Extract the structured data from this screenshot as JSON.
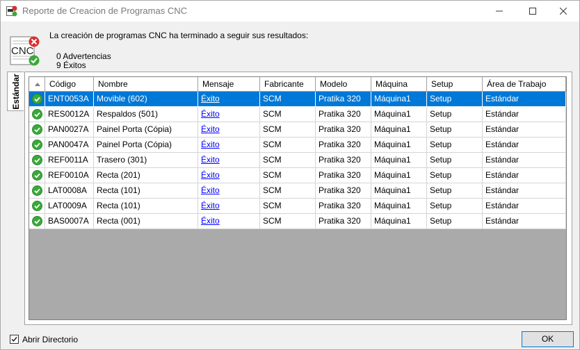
{
  "window": {
    "title": "Reporte de Creacion de Programas CNC"
  },
  "header": {
    "icon_text": "CNC",
    "message": "La creación de programas CNC ha terminado a seguir sus resultados:",
    "warnings": "0 Advertencias",
    "successes": "9 Éxitos"
  },
  "tab": {
    "label": "Estándar"
  },
  "grid": {
    "columns": [
      "Código",
      "Nombre",
      "Mensaje",
      "Fabricante",
      "Modelo",
      "Máquina",
      "Setup",
      "Área de Trabajo"
    ],
    "rows": [
      {
        "codigo": "ENT0053A",
        "nombre": "Movible (602)",
        "mensaje": "Éxito",
        "fabricante": "SCM",
        "modelo": "Pratika 320",
        "maquina": "Máquina1",
        "setup": "Setup",
        "area": "Estándar",
        "selected": true
      },
      {
        "codigo": "RES0012A",
        "nombre": "Respaldos (501)",
        "mensaje": "Éxito",
        "fabricante": "SCM",
        "modelo": "Pratika 320",
        "maquina": "Máquina1",
        "setup": "Setup",
        "area": "Estándar"
      },
      {
        "codigo": "PAN0027A",
        "nombre": "Painel Porta (Cópia)",
        "mensaje": "Éxito",
        "fabricante": "SCM",
        "modelo": "Pratika 320",
        "maquina": "Máquina1",
        "setup": "Setup",
        "area": "Estándar"
      },
      {
        "codigo": "PAN0047A",
        "nombre": "Painel Porta (Cópia)",
        "mensaje": "Éxito",
        "fabricante": "SCM",
        "modelo": "Pratika 320",
        "maquina": "Máquina1",
        "setup": "Setup",
        "area": "Estándar"
      },
      {
        "codigo": "REF0011A",
        "nombre": "Trasero (301)",
        "mensaje": "Éxito",
        "fabricante": "SCM",
        "modelo": "Pratika 320",
        "maquina": "Máquina1",
        "setup": "Setup",
        "area": "Estándar"
      },
      {
        "codigo": "REF0010A",
        "nombre": "Recta (201)",
        "mensaje": "Éxito",
        "fabricante": "SCM",
        "modelo": "Pratika 320",
        "maquina": "Máquina1",
        "setup": "Setup",
        "area": "Estándar"
      },
      {
        "codigo": "LAT0008A",
        "nombre": "Recta (101)",
        "mensaje": "Éxito",
        "fabricante": "SCM",
        "modelo": "Pratika 320",
        "maquina": "Máquina1",
        "setup": "Setup",
        "area": "Estándar"
      },
      {
        "codigo": "LAT0009A",
        "nombre": "Recta (101)",
        "mensaje": "Éxito",
        "fabricante": "SCM",
        "modelo": "Pratika 320",
        "maquina": "Máquina1",
        "setup": "Setup",
        "area": "Estándar"
      },
      {
        "codigo": "BAS0007A",
        "nombre": "Recta (001)",
        "mensaje": "Éxito",
        "fabricante": "SCM",
        "modelo": "Pratika 320",
        "maquina": "Máquina1",
        "setup": "Setup",
        "area": "Estándar"
      }
    ]
  },
  "footer": {
    "open_dir_label": "Abrir Directorio",
    "open_dir_checked": true,
    "ok_label": "OK"
  },
  "colors": {
    "selection": "#0078d7",
    "link": "#0000ff",
    "grid_background": "#aaaaaa",
    "success_icon": "#3aa93a"
  },
  "icons": {
    "app": "cnc-app-icon",
    "status": "success-check-icon",
    "minimize": "minimize-icon",
    "maximize": "maximize-icon",
    "close": "close-icon"
  }
}
